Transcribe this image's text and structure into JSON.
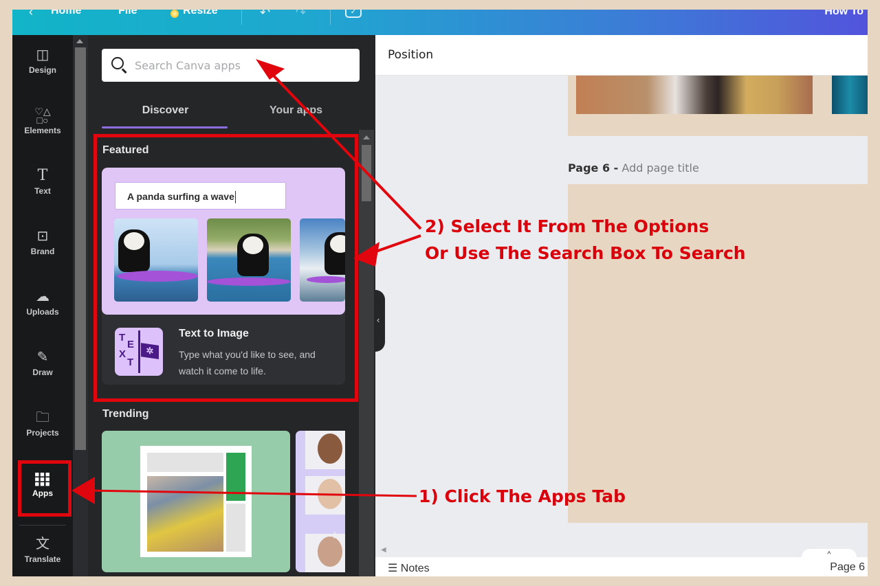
{
  "topbar": {
    "back_icon": "chevron-left-icon",
    "home_label": "Home",
    "file_label": "File",
    "resize_label": "Resize",
    "undo_icon": "undo-icon",
    "redo_icon": "redo-icon",
    "saved_icon": "cloud-check-icon",
    "title": "How To",
    "colors": {
      "start": "#12b4c8",
      "end": "#5254dc"
    }
  },
  "rail": {
    "items": [
      {
        "label": "Design",
        "icon": "layout-icon"
      },
      {
        "label": "Elements",
        "icon": "shapes-icon"
      },
      {
        "label": "Text",
        "icon": "text-icon"
      },
      {
        "label": "Brand",
        "icon": "brand-icon"
      },
      {
        "label": "Uploads",
        "icon": "cloud-upload-icon"
      },
      {
        "label": "Draw",
        "icon": "draw-icon"
      },
      {
        "label": "Projects",
        "icon": "folder-icon"
      },
      {
        "label": "Apps",
        "icon": "apps-grid-icon",
        "active": true
      },
      {
        "label": "Translate",
        "icon": "translate-icon"
      }
    ]
  },
  "panel": {
    "search": {
      "placeholder": "Search Canva apps",
      "value": ""
    },
    "tabs": [
      {
        "label": "Discover",
        "active": true
      },
      {
        "label": "Your apps",
        "active": false
      }
    ],
    "featured": {
      "title": "Featured",
      "prompt_text": "A panda surfing a wave",
      "app_name": "Text to Image",
      "app_description": "Type what you'd like to see, and watch it come to life.",
      "icon_text": [
        "T",
        "E",
        "X",
        "T"
      ]
    },
    "trending": {
      "title": "Trending"
    },
    "accent": "#8b6ee0"
  },
  "canvas": {
    "toolbar_label": "Position",
    "page_label_bold": "Page 6 -",
    "page_label_placeholder": "Add page title",
    "notes_label": "Notes",
    "page_indicator": "Page 6"
  },
  "annotations": {
    "step1": "1) Click The Apps Tab",
    "step2_line1": "2) Select It From The Options",
    "step2_line2": "Or Use The Search Box To Search",
    "color": "#d9000b"
  }
}
